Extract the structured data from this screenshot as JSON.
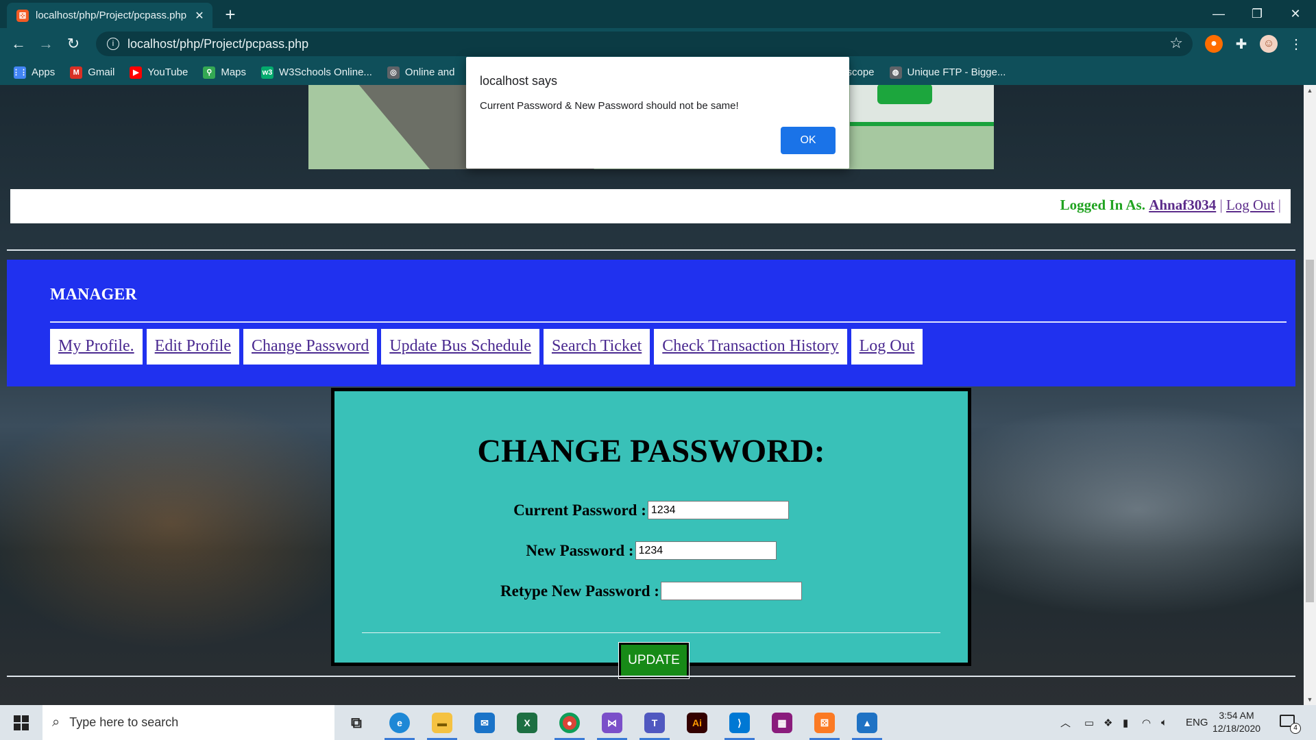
{
  "browser": {
    "tab_title": "localhost/php/Project/pcpass.php",
    "tab_favicon_glyph": "⚄",
    "url": "localhost/php/Project/pcpass.php",
    "bookmarks": [
      {
        "label": "Apps",
        "icon": "apps-grid-icon",
        "color": "#4285f4",
        "glyph": "⋮⋮"
      },
      {
        "label": "Gmail",
        "icon": "gmail-icon",
        "color": "#d93025",
        "glyph": "M"
      },
      {
        "label": "YouTube",
        "icon": "youtube-icon",
        "color": "#ff0000",
        "glyph": "▶"
      },
      {
        "label": "Maps",
        "icon": "maps-icon",
        "color": "#34a853",
        "glyph": "⚲"
      },
      {
        "label": "W3Schools Online...",
        "icon": "w3schools-icon",
        "color": "#04aa6d",
        "glyph": "w3"
      },
      {
        "label": "Online and",
        "icon": "globe-icon",
        "color": "#5f6368",
        "glyph": "◎"
      },
      {
        "label": "scope",
        "icon": "",
        "color": "",
        "glyph": ""
      },
      {
        "label": "Unique FTP - Bigge...",
        "icon": "globe-icon",
        "color": "#5f6368",
        "glyph": "◍"
      }
    ]
  },
  "dialog": {
    "title": "localhost says",
    "message": "Current Password & New Password should not be same!",
    "ok_label": "OK"
  },
  "login_bar": {
    "prefix": "Logged In As.",
    "username": "Ahnaf3034",
    "separator": "|",
    "logout_label": "Log Out",
    "trailing_sep": "|"
  },
  "manager": {
    "heading": "MANAGER",
    "menu": [
      "My Profile.",
      "Edit Profile",
      "Change Password",
      "Update Bus Schedule",
      "Search Ticket",
      "Check Transaction History",
      "Log Out"
    ]
  },
  "form": {
    "heading": "CHANGE PASSWORD:",
    "current_label": "Current Password :",
    "current_value": "1234",
    "new_label": "New Password :",
    "new_value": "1234",
    "retype_label": "Retype New Password :",
    "retype_value": "",
    "update_label": "UPDATE"
  },
  "taskbar": {
    "search_placeholder": "Type here to search",
    "language": "ENG",
    "time": "3:54 AM",
    "date": "12/18/2020",
    "notification_count": "4"
  },
  "colors": {
    "manager_bg": "#2031ef",
    "panel_bg": "#39c1b8",
    "update_bg": "#178a17",
    "logged_in_green": "#21a321",
    "ok_blue": "#1a73e8"
  }
}
